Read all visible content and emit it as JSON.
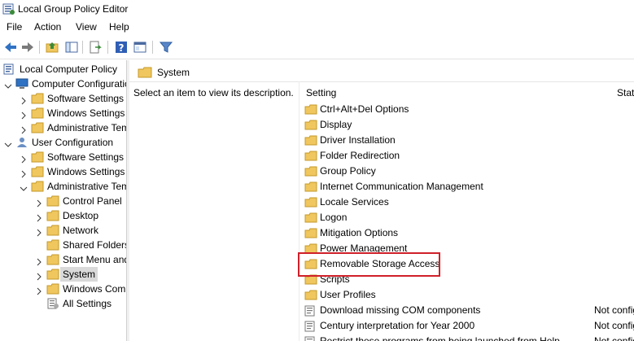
{
  "window": {
    "title": "Local Group Policy Editor"
  },
  "menu": [
    "File",
    "Action",
    "View",
    "Help"
  ],
  "toolbar": {
    "buttons": [
      "back-icon",
      "forward-icon",
      "up-folder-icon",
      "show-hide-tree-icon",
      "export-list-icon",
      "help-icon",
      "properties-icon",
      "filter-icon"
    ]
  },
  "tree": [
    {
      "label": "Local Computer Policy",
      "icon": "policy-icon",
      "level": 0,
      "expander": "none"
    },
    {
      "label": "Computer Configuration",
      "icon": "computer-icon",
      "level": 1,
      "expander": "expanded"
    },
    {
      "label": "Software Settings",
      "icon": "folder-icon",
      "level": 2,
      "expander": "collapsed"
    },
    {
      "label": "Windows Settings",
      "icon": "folder-icon",
      "level": 2,
      "expander": "collapsed"
    },
    {
      "label": "Administrative Templates",
      "icon": "folder-icon",
      "level": 2,
      "expander": "collapsed"
    },
    {
      "label": "User Configuration",
      "icon": "user-icon",
      "level": 1,
      "expander": "expanded"
    },
    {
      "label": "Software Settings",
      "icon": "folder-icon",
      "level": 2,
      "expander": "collapsed"
    },
    {
      "label": "Windows Settings",
      "icon": "folder-icon",
      "level": 2,
      "expander": "collapsed"
    },
    {
      "label": "Administrative Templates",
      "icon": "folder-icon",
      "level": 2,
      "expander": "expanded"
    },
    {
      "label": "Control Panel",
      "icon": "folder-icon",
      "level": 3,
      "expander": "collapsed"
    },
    {
      "label": "Desktop",
      "icon": "folder-icon",
      "level": 3,
      "expander": "collapsed"
    },
    {
      "label": "Network",
      "icon": "folder-icon",
      "level": 3,
      "expander": "collapsed"
    },
    {
      "label": "Shared Folders",
      "icon": "folder-icon",
      "level": 3,
      "expander": "none"
    },
    {
      "label": "Start Menu and Taskbar",
      "icon": "folder-icon",
      "level": 3,
      "expander": "collapsed"
    },
    {
      "label": "System",
      "icon": "folder-icon",
      "level": 3,
      "expander": "collapsed",
      "selected": true
    },
    {
      "label": "Windows Components",
      "icon": "folder-icon",
      "level": 3,
      "expander": "collapsed"
    },
    {
      "label": "All Settings",
      "icon": "all-settings-icon",
      "level": 3,
      "expander": "none"
    }
  ],
  "content": {
    "header": "System",
    "description": "Select an item to view its description.",
    "columns": {
      "setting": "Setting",
      "state": "State"
    },
    "rows": [
      {
        "label": "Ctrl+Alt+Del Options",
        "type": "folder",
        "state": ""
      },
      {
        "label": "Display",
        "type": "folder",
        "state": ""
      },
      {
        "label": "Driver Installation",
        "type": "folder",
        "state": ""
      },
      {
        "label": "Folder Redirection",
        "type": "folder",
        "state": ""
      },
      {
        "label": "Group Policy",
        "type": "folder",
        "state": ""
      },
      {
        "label": "Internet Communication Management",
        "type": "folder",
        "state": ""
      },
      {
        "label": "Locale Services",
        "type": "folder",
        "state": ""
      },
      {
        "label": "Logon",
        "type": "folder",
        "state": ""
      },
      {
        "label": "Mitigation Options",
        "type": "folder",
        "state": ""
      },
      {
        "label": "Power Management",
        "type": "folder",
        "state": ""
      },
      {
        "label": "Removable Storage Access",
        "type": "folder",
        "state": "",
        "highlighted": true
      },
      {
        "label": "Scripts",
        "type": "folder",
        "state": ""
      },
      {
        "label": "User Profiles",
        "type": "folder",
        "state": ""
      },
      {
        "label": "Download missing COM components",
        "type": "setting",
        "state": "Not configured"
      },
      {
        "label": "Century interpretation for Year 2000",
        "type": "setting",
        "state": "Not configured"
      },
      {
        "label": "Restrict these programs from being launched from Help",
        "type": "setting",
        "state": "Not configured"
      }
    ]
  },
  "colors": {
    "highlight_border": "#d0202a",
    "selection": "#d9d9d9",
    "folder": "#f0c75e"
  }
}
